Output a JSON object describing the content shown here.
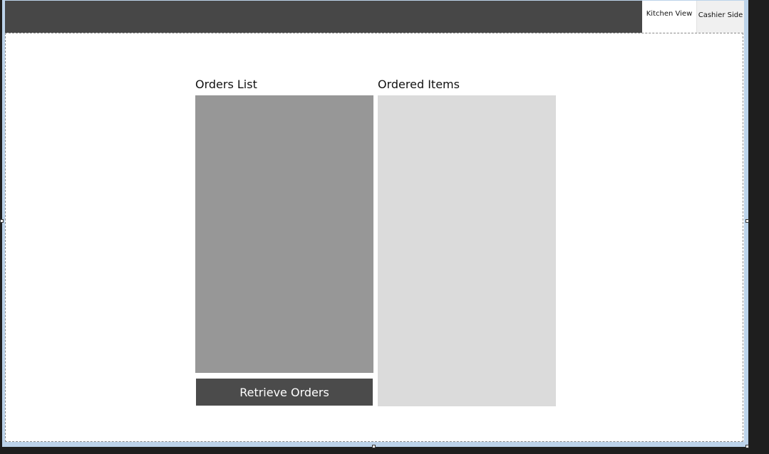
{
  "tabs": [
    {
      "label": "Kitchen View",
      "selected": true
    },
    {
      "label": "Cashier Side",
      "selected": false
    }
  ],
  "orders_panel": {
    "label": "Orders List",
    "button_label": "Retrieve Orders"
  },
  "items_panel": {
    "label": "Ordered Items"
  },
  "colors": {
    "topbar": "#474747",
    "orders_list_bg": "#979797",
    "items_list_bg": "#dbdbdb",
    "button_bg": "#4b4b4b",
    "designer_frame": "#bcd3ea"
  }
}
